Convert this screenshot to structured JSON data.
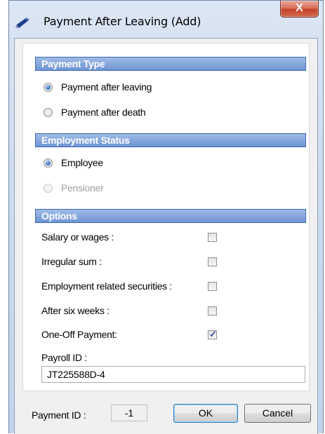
{
  "window": {
    "title": "Payment After Leaving (Add)",
    "close_glyph": "X",
    "icon": "pencil-icon"
  },
  "payment_type": {
    "header": "Payment Type",
    "options": [
      {
        "label": "Payment after leaving",
        "checked": true,
        "disabled": false
      },
      {
        "label": "Payment after death",
        "checked": false,
        "disabled": false
      }
    ]
  },
  "employment_status": {
    "header": "Employment Status",
    "options": [
      {
        "label": "Employee",
        "checked": true,
        "disabled": false
      },
      {
        "label": "Pensioner",
        "checked": false,
        "disabled": true
      }
    ]
  },
  "options": {
    "header": "Options",
    "items": [
      {
        "label": "Salary or wages :",
        "checked": false
      },
      {
        "label": "Irregular sum :",
        "checked": false
      },
      {
        "label": "Employment related securities :",
        "checked": false
      },
      {
        "label": "After six weeks :",
        "checked": false
      },
      {
        "label": "One-Off Payment:",
        "checked": true
      }
    ],
    "payroll_label": "Payroll ID :",
    "payroll_value": "JT225588D-4"
  },
  "footer": {
    "payment_id_label": "Payment ID :",
    "payment_id_value": "-1",
    "ok_label": "OK",
    "cancel_label": "Cancel"
  },
  "colors": {
    "section_header": "#6f95d4",
    "close_button": "#c4412a",
    "radio_selected": "#3a72c6"
  }
}
